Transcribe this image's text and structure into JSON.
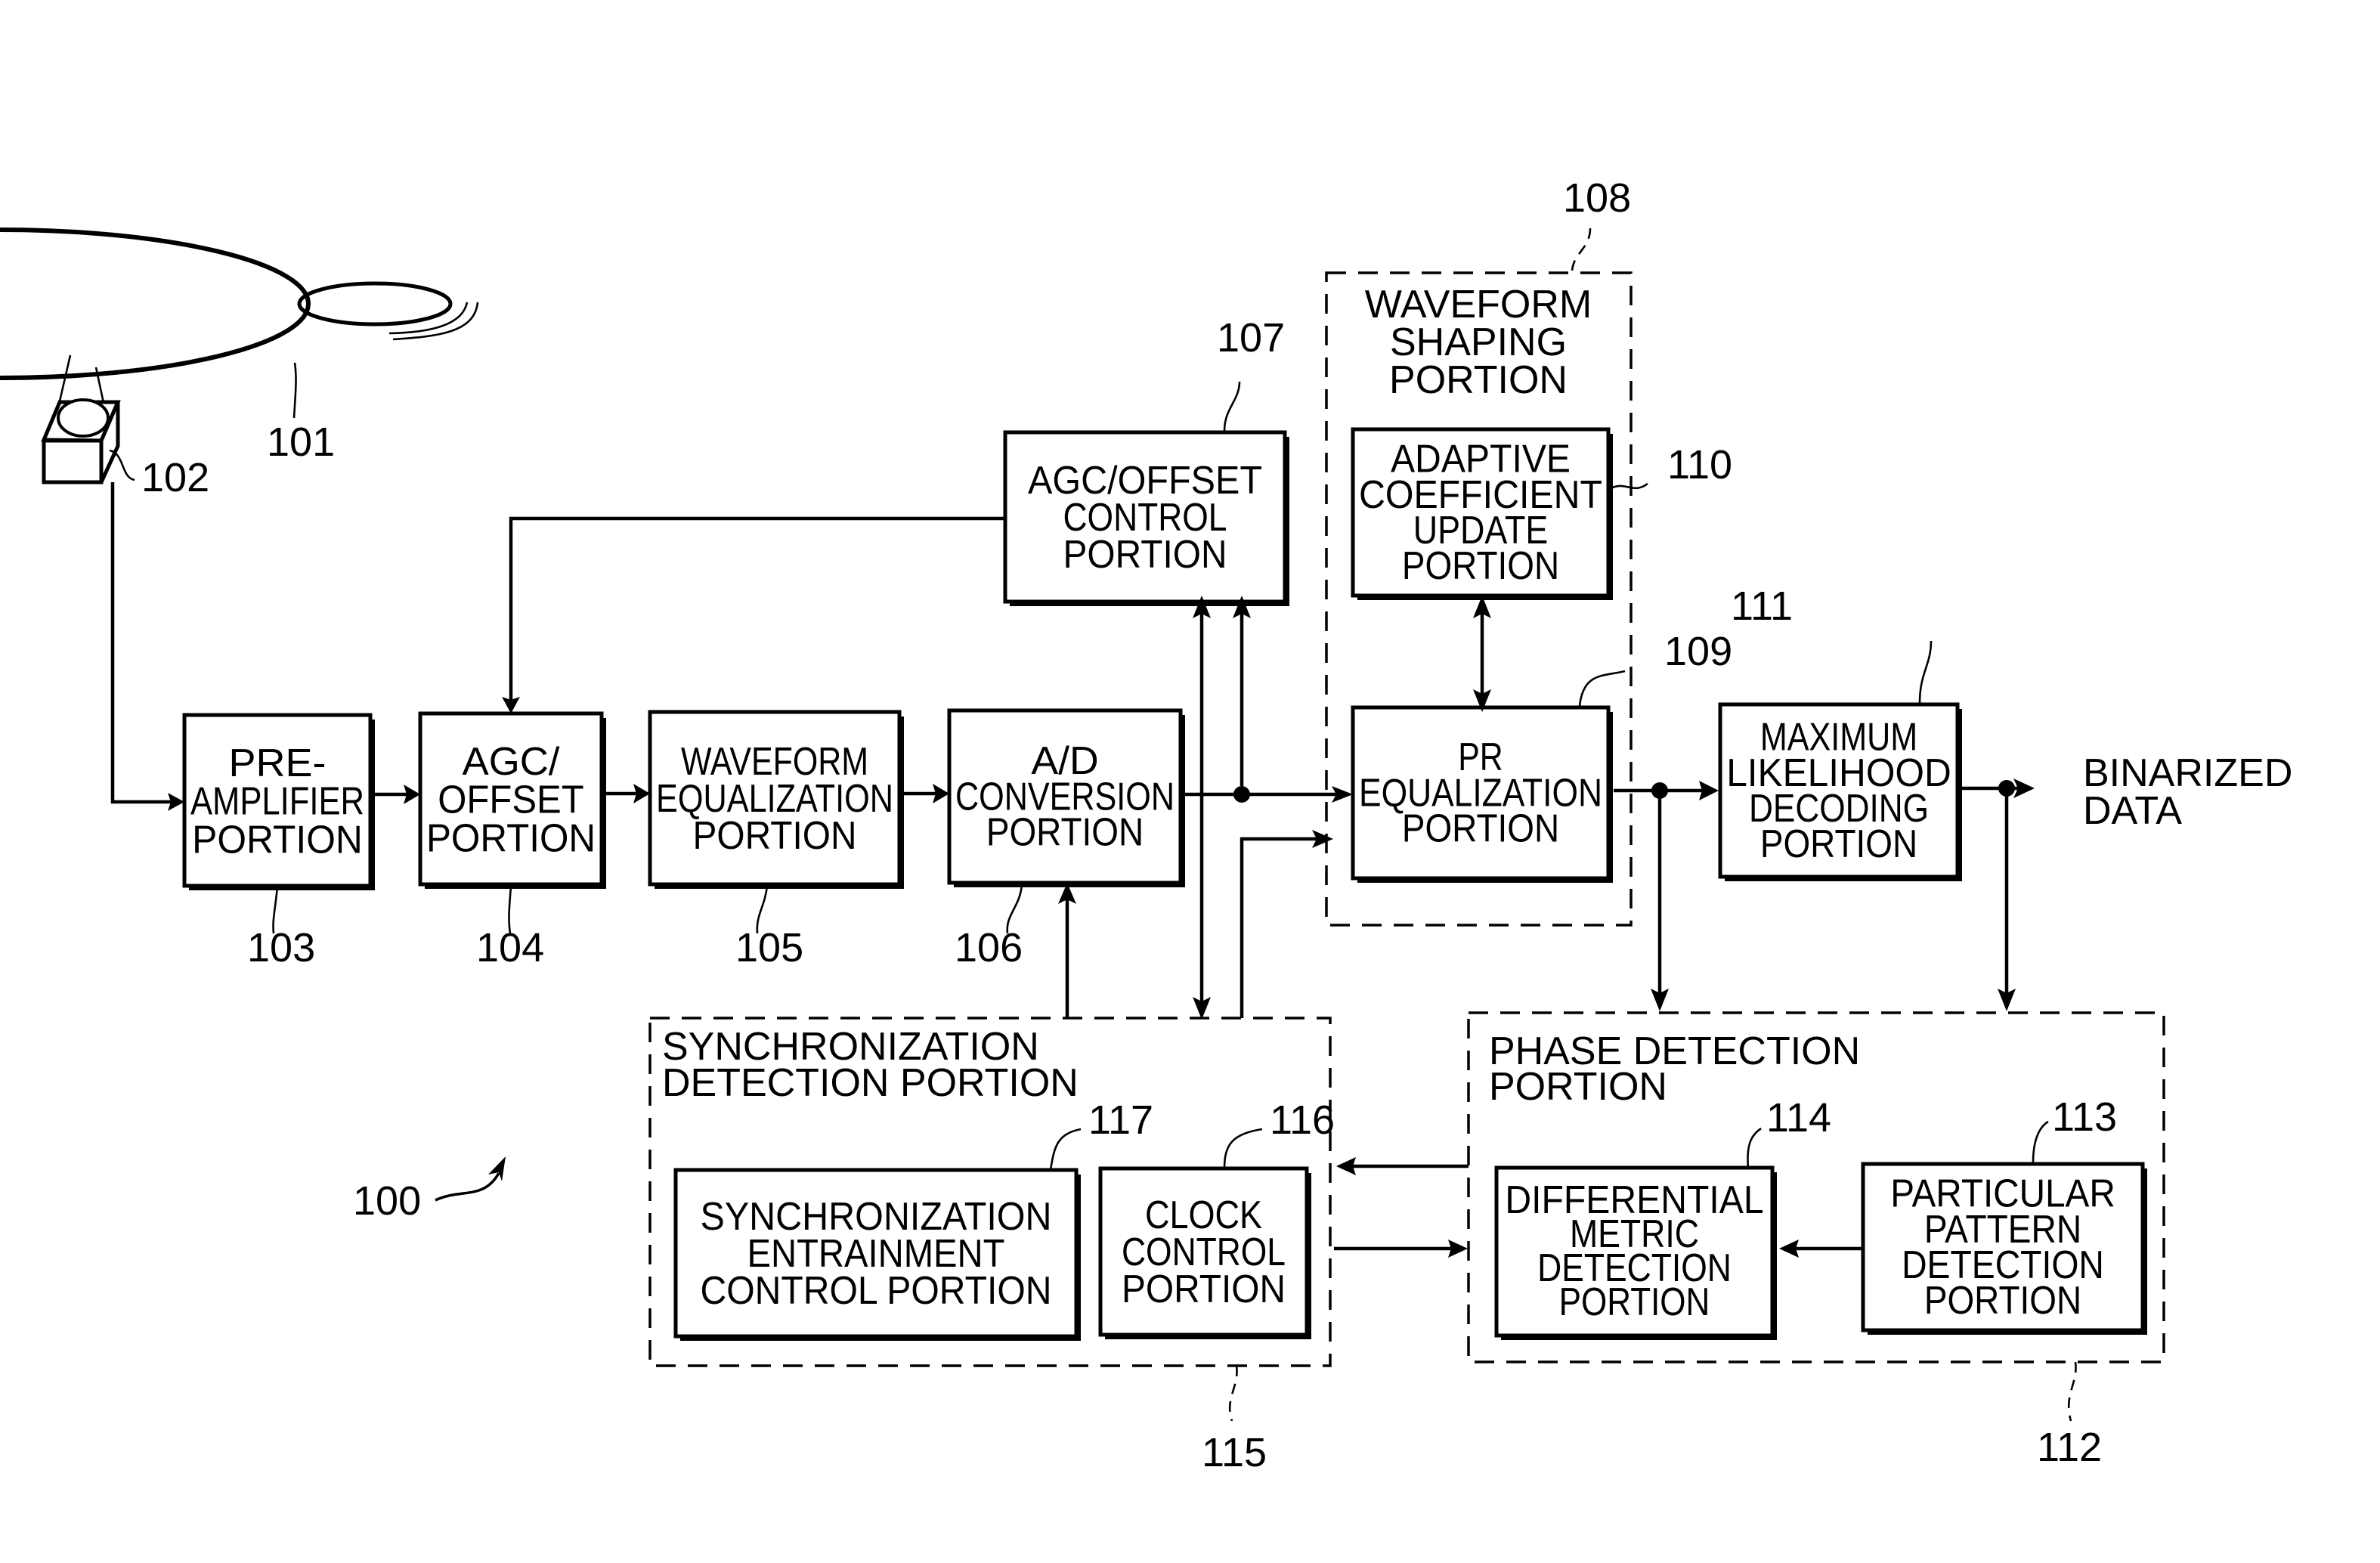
{
  "figure": {
    "system_ref": "100",
    "disk": {
      "ref": "101"
    },
    "pickup": {
      "ref": "102"
    },
    "blocks": {
      "preamp": {
        "ref": "103",
        "lines": [
          "PRE-",
          "AMPLIFIER",
          "PORTION"
        ]
      },
      "agc_offset": {
        "ref": "104",
        "lines": [
          "AGC/",
          "OFFSET",
          "PORTION"
        ]
      },
      "waveform_eq": {
        "ref": "105",
        "lines": [
          "WAVEFORM",
          "EQUALIZATION",
          "PORTION"
        ]
      },
      "ad_conv": {
        "ref": "106",
        "lines": [
          "A/D",
          "CONVERSION",
          "PORTION"
        ]
      },
      "agc_offset_control": {
        "ref": "107",
        "lines": [
          "AGC/OFFSET",
          "CONTROL",
          "PORTION"
        ]
      },
      "adaptive_coef": {
        "ref": "110",
        "lines": [
          "ADAPTIVE",
          "COEFFICIENT",
          "UPDATE",
          "PORTION"
        ]
      },
      "pr_eq": {
        "ref": "109",
        "lines": [
          "PR",
          "EQUALIZATION",
          "PORTION"
        ]
      },
      "ml_decoding": {
        "ref": "111",
        "lines": [
          "MAXIMUM",
          "LIKELIHOOD",
          "DECODING",
          "PORTION"
        ]
      },
      "particular_pattern": {
        "ref": "113",
        "lines": [
          "PARTICULAR",
          "PATTERN",
          "DETECTION",
          "PORTION"
        ]
      },
      "differential_metric": {
        "ref": "114",
        "lines": [
          "DIFFERENTIAL",
          "METRIC",
          "DETECTION",
          "PORTION"
        ]
      },
      "clock_control": {
        "ref": "116",
        "lines": [
          "CLOCK",
          "CONTROL",
          "PORTION"
        ]
      },
      "sync_entrainment": {
        "ref": "117",
        "lines": [
          "SYNCHRONIZATION",
          "ENTRAINMENT",
          "CONTROL PORTION"
        ]
      }
    },
    "groups": {
      "waveform_shaping": {
        "ref": "108",
        "lines": [
          "WAVEFORM",
          "SHAPING",
          "PORTION"
        ]
      },
      "phase_detection": {
        "ref": "112",
        "lines": [
          "PHASE DETECTION",
          "PORTION"
        ]
      },
      "sync_detection": {
        "ref": "115",
        "lines": [
          "SYNCHRONIZATION",
          "DETECTION PORTION"
        ]
      }
    },
    "output_label": [
      "BINARIZED",
      "DATA"
    ]
  }
}
